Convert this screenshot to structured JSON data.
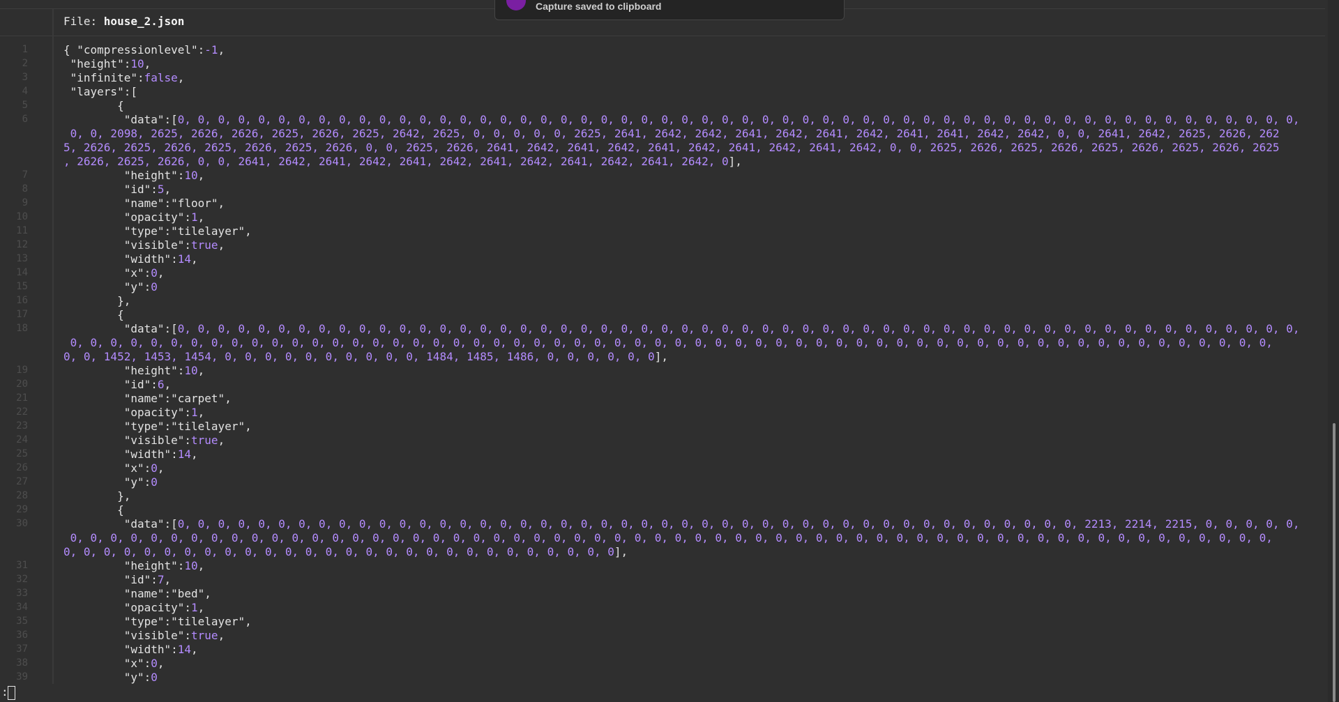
{
  "notification": {
    "text": "Capture saved to clipboard",
    "icon": "app-icon"
  },
  "header": {
    "prefix": "File: ",
    "filename": "house_2.json"
  },
  "editor": {
    "lines": [
      {
        "n": "1",
        "segs": [
          {
            "t": "{ \"compressionlevel\":"
          },
          {
            "t": "-1",
            "c": "num"
          },
          {
            "t": ","
          }
        ]
      },
      {
        "n": "2",
        "segs": [
          {
            "t": " \"height\":"
          },
          {
            "t": "10",
            "c": "num"
          },
          {
            "t": ","
          }
        ]
      },
      {
        "n": "3",
        "segs": [
          {
            "t": " \"infinite\":"
          },
          {
            "t": "false",
            "c": "num"
          },
          {
            "t": ","
          }
        ]
      },
      {
        "n": "4",
        "segs": [
          {
            "t": " \"layers\":["
          }
        ]
      },
      {
        "n": "5",
        "segs": [
          {
            "t": "        {"
          }
        ]
      },
      {
        "n": "6",
        "segs": [
          {
            "t": "         \"data\":["
          },
          {
            "t": "0, 0, 0, 0, 0, 0, 0, 0, 0, 0, 0, 0, 0, 0, 0, 0, 0, 0, 0, 0, 0, 0, 0, 0, 0, 0, 0, 0, 0, 0, 0, 0, 0, 0, 0, 0, 0, 0, 0, 0, 0, 0, 0, 0, 0, 0, 0, 0, 0, 0, 0, 0, 0, 0, 0, 0,",
            "c": "num"
          }
        ]
      },
      {
        "n": "",
        "segs": [
          {
            "t": " 0, 0, 2098, 2625, 2626, 2626, 2625, 2626, 2625, 2642, 2625, 0, 0, 0, 0, 0, 2625, 2641, 2642, 2642, 2641, 2642, 2641, 2642, 2641, 2641, 2642, 2642, 0, 0, 2641, 2642, 2625, 2626, 262",
            "c": "num"
          }
        ]
      },
      {
        "n": "",
        "segs": [
          {
            "t": "5, 2626, 2625, 2626, 2625, 2626, 2625, 2626, 0, 0, 2625, 2626, 2641, 2642, 2641, 2642, 2641, 2642, 2641, 2642, 2641, 2642, 0, 0, 2625, 2626, 2625, 2626, 2625, 2626, 2625, 2626, 2625",
            "c": "num"
          }
        ]
      },
      {
        "n": "",
        "segs": [
          {
            "t": ", 2626, 2625, 2626, 0, 0, 2641, 2642, 2641, 2642, 2641, 2642, 2641, 2642, 2641, 2642, 2641, 2642, 0",
            "c": "num"
          },
          {
            "t": "],"
          }
        ]
      },
      {
        "n": "7",
        "segs": [
          {
            "t": "         \"height\":"
          },
          {
            "t": "10",
            "c": "num"
          },
          {
            "t": ","
          }
        ]
      },
      {
        "n": "8",
        "segs": [
          {
            "t": "         \"id\":"
          },
          {
            "t": "5",
            "c": "num"
          },
          {
            "t": ","
          }
        ]
      },
      {
        "n": "9",
        "segs": [
          {
            "t": "         \"name\":\"floor\","
          }
        ]
      },
      {
        "n": "10",
        "segs": [
          {
            "t": "         \"opacity\":"
          },
          {
            "t": "1",
            "c": "num"
          },
          {
            "t": ","
          }
        ]
      },
      {
        "n": "11",
        "segs": [
          {
            "t": "         \"type\":\"tilelayer\","
          }
        ]
      },
      {
        "n": "12",
        "segs": [
          {
            "t": "         \"visible\":"
          },
          {
            "t": "true",
            "c": "num"
          },
          {
            "t": ","
          }
        ]
      },
      {
        "n": "13",
        "segs": [
          {
            "t": "         \"width\":"
          },
          {
            "t": "14",
            "c": "num"
          },
          {
            "t": ","
          }
        ]
      },
      {
        "n": "14",
        "segs": [
          {
            "t": "         \"x\":"
          },
          {
            "t": "0",
            "c": "num"
          },
          {
            "t": ","
          }
        ]
      },
      {
        "n": "15",
        "segs": [
          {
            "t": "         \"y\":"
          },
          {
            "t": "0",
            "c": "num"
          }
        ]
      },
      {
        "n": "16",
        "segs": [
          {
            "t": "        },"
          }
        ]
      },
      {
        "n": "17",
        "segs": [
          {
            "t": "        {"
          }
        ]
      },
      {
        "n": "18",
        "segs": [
          {
            "t": "         \"data\":["
          },
          {
            "t": "0, 0, 0, 0, 0, 0, 0, 0, 0, 0, 0, 0, 0, 0, 0, 0, 0, 0, 0, 0, 0, 0, 0, 0, 0, 0, 0, 0, 0, 0, 0, 0, 0, 0, 0, 0, 0, 0, 0, 0, 0, 0, 0, 0, 0, 0, 0, 0, 0, 0, 0, 0, 0, 0, 0, 0,",
            "c": "num"
          }
        ]
      },
      {
        "n": "",
        "segs": [
          {
            "t": " 0, 0, 0, 0, 0, 0, 0, 0, 0, 0, 0, 0, 0, 0, 0, 0, 0, 0, 0, 0, 0, 0, 0, 0, 0, 0, 0, 0, 0, 0, 0, 0, 0, 0, 0, 0, 0, 0, 0, 0, 0, 0, 0, 0, 0, 0, 0, 0, 0, 0, 0, 0, 0, 0, 0, 0, 0, 0, 0, 0,",
            "c": "num"
          }
        ]
      },
      {
        "n": "",
        "segs": [
          {
            "t": "0, 0, 1452, 1453, 1454, 0, 0, 0, 0, 0, 0, 0, 0, 0, 0, 1484, 1485, 1486, 0, 0, 0, 0, 0, 0",
            "c": "num"
          },
          {
            "t": "],"
          }
        ]
      },
      {
        "n": "19",
        "segs": [
          {
            "t": "         \"height\":"
          },
          {
            "t": "10",
            "c": "num"
          },
          {
            "t": ","
          }
        ]
      },
      {
        "n": "20",
        "segs": [
          {
            "t": "         \"id\":"
          },
          {
            "t": "6",
            "c": "num"
          },
          {
            "t": ","
          }
        ]
      },
      {
        "n": "21",
        "segs": [
          {
            "t": "         \"name\":\"carpet\","
          }
        ]
      },
      {
        "n": "22",
        "segs": [
          {
            "t": "         \"opacity\":"
          },
          {
            "t": "1",
            "c": "num"
          },
          {
            "t": ","
          }
        ]
      },
      {
        "n": "23",
        "segs": [
          {
            "t": "         \"type\":\"tilelayer\","
          }
        ]
      },
      {
        "n": "24",
        "segs": [
          {
            "t": "         \"visible\":"
          },
          {
            "t": "true",
            "c": "num"
          },
          {
            "t": ","
          }
        ]
      },
      {
        "n": "25",
        "segs": [
          {
            "t": "         \"width\":"
          },
          {
            "t": "14",
            "c": "num"
          },
          {
            "t": ","
          }
        ]
      },
      {
        "n": "26",
        "segs": [
          {
            "t": "         \"x\":"
          },
          {
            "t": "0",
            "c": "num"
          },
          {
            "t": ","
          }
        ]
      },
      {
        "n": "27",
        "segs": [
          {
            "t": "         \"y\":"
          },
          {
            "t": "0",
            "c": "num"
          }
        ]
      },
      {
        "n": "28",
        "segs": [
          {
            "t": "        },"
          }
        ]
      },
      {
        "n": "29",
        "segs": [
          {
            "t": "        {"
          }
        ]
      },
      {
        "n": "30",
        "segs": [
          {
            "t": "         \"data\":["
          },
          {
            "t": "0, 0, 0, 0, 0, 0, 0, 0, 0, 0, 0, 0, 0, 0, 0, 0, 0, 0, 0, 0, 0, 0, 0, 0, 0, 0, 0, 0, 0, 0, 0, 0, 0, 0, 0, 0, 0, 0, 0, 0, 0, 0, 0, 0, 0, 2213, 2214, 2215, 0, 0, 0, 0, 0,",
            "c": "num"
          }
        ]
      },
      {
        "n": "",
        "segs": [
          {
            "t": " 0, 0, 0, 0, 0, 0, 0, 0, 0, 0, 0, 0, 0, 0, 0, 0, 0, 0, 0, 0, 0, 0, 0, 0, 0, 0, 0, 0, 0, 0, 0, 0, 0, 0, 0, 0, 0, 0, 0, 0, 0, 0, 0, 0, 0, 0, 0, 0, 0, 0, 0, 0, 0, 0, 0, 0, 0, 0, 0, 0,",
            "c": "num"
          }
        ]
      },
      {
        "n": "",
        "segs": [
          {
            "t": "0, 0, 0, 0, 0, 0, 0, 0, 0, 0, 0, 0, 0, 0, 0, 0, 0, 0, 0, 0, 0, 0, 0, 0, 0, 0, 0, 0",
            "c": "num"
          },
          {
            "t": "],"
          }
        ]
      },
      {
        "n": "31",
        "segs": [
          {
            "t": "         \"height\":"
          },
          {
            "t": "10",
            "c": "num"
          },
          {
            "t": ","
          }
        ]
      },
      {
        "n": "32",
        "segs": [
          {
            "t": "         \"id\":"
          },
          {
            "t": "7",
            "c": "num"
          },
          {
            "t": ","
          }
        ]
      },
      {
        "n": "33",
        "segs": [
          {
            "t": "         \"name\":\"bed\","
          }
        ]
      },
      {
        "n": "34",
        "segs": [
          {
            "t": "         \"opacity\":"
          },
          {
            "t": "1",
            "c": "num"
          },
          {
            "t": ","
          }
        ]
      },
      {
        "n": "35",
        "segs": [
          {
            "t": "         \"type\":\"tilelayer\","
          }
        ]
      },
      {
        "n": "36",
        "segs": [
          {
            "t": "         \"visible\":"
          },
          {
            "t": "true",
            "c": "num"
          },
          {
            "t": ","
          }
        ]
      },
      {
        "n": "37",
        "segs": [
          {
            "t": "         \"width\":"
          },
          {
            "t": "14",
            "c": "num"
          },
          {
            "t": ","
          }
        ]
      },
      {
        "n": "38",
        "segs": [
          {
            "t": "         \"x\":"
          },
          {
            "t": "0",
            "c": "num"
          },
          {
            "t": ","
          }
        ]
      },
      {
        "n": "39",
        "segs": [
          {
            "t": "         \"y\":"
          },
          {
            "t": "0",
            "c": "num"
          }
        ]
      }
    ]
  },
  "cmdline": {
    "prompt": ":"
  },
  "colors": {
    "background": "#2f2f2f",
    "text": "#e3e3e3",
    "number": "#b48cff",
    "line_number": "#4e4e4e",
    "notification_icon": "#7a1fa2"
  }
}
